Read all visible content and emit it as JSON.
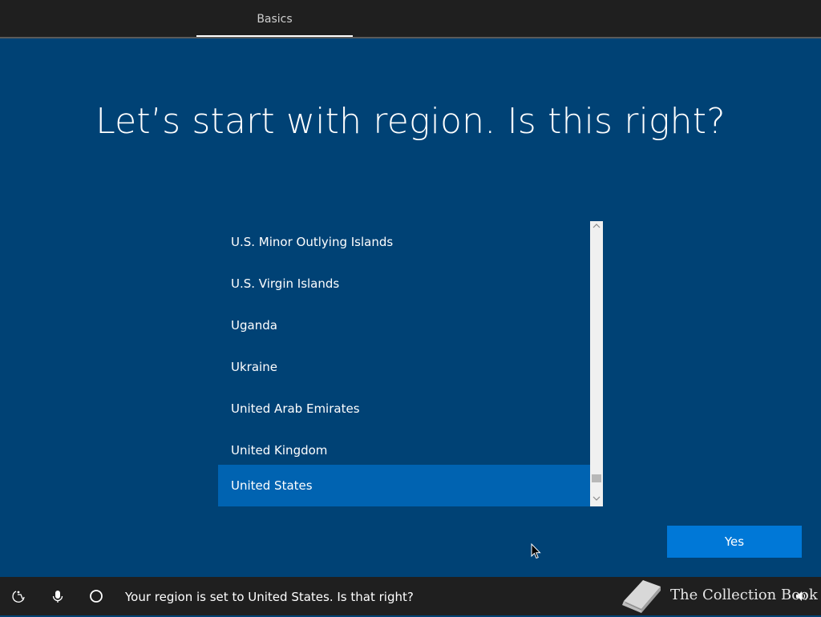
{
  "header": {
    "tab_label": "Basics"
  },
  "main": {
    "title": "Let’s start with region. Is this right?",
    "regions": [
      {
        "label": "U.S. Minor Outlying Islands",
        "selected": false
      },
      {
        "label": "U.S. Virgin Islands",
        "selected": false
      },
      {
        "label": "Uganda",
        "selected": false
      },
      {
        "label": "Ukraine",
        "selected": false
      },
      {
        "label": "United Arab Emirates",
        "selected": false
      },
      {
        "label": "United Kingdom",
        "selected": false
      },
      {
        "label": "United States",
        "selected": true
      }
    ],
    "yes_label": "Yes"
  },
  "footer": {
    "status_text": "Your region is set to United States. Is that right?",
    "icons": [
      "accessibility-icon",
      "microphone-icon",
      "cortana-icon",
      "volume-icon"
    ]
  },
  "watermark": {
    "text": "The Collection Book"
  },
  "colors": {
    "background": "#004275",
    "selected": "#0063b1",
    "button": "#0078d7",
    "bars": "#1f1f1f"
  }
}
